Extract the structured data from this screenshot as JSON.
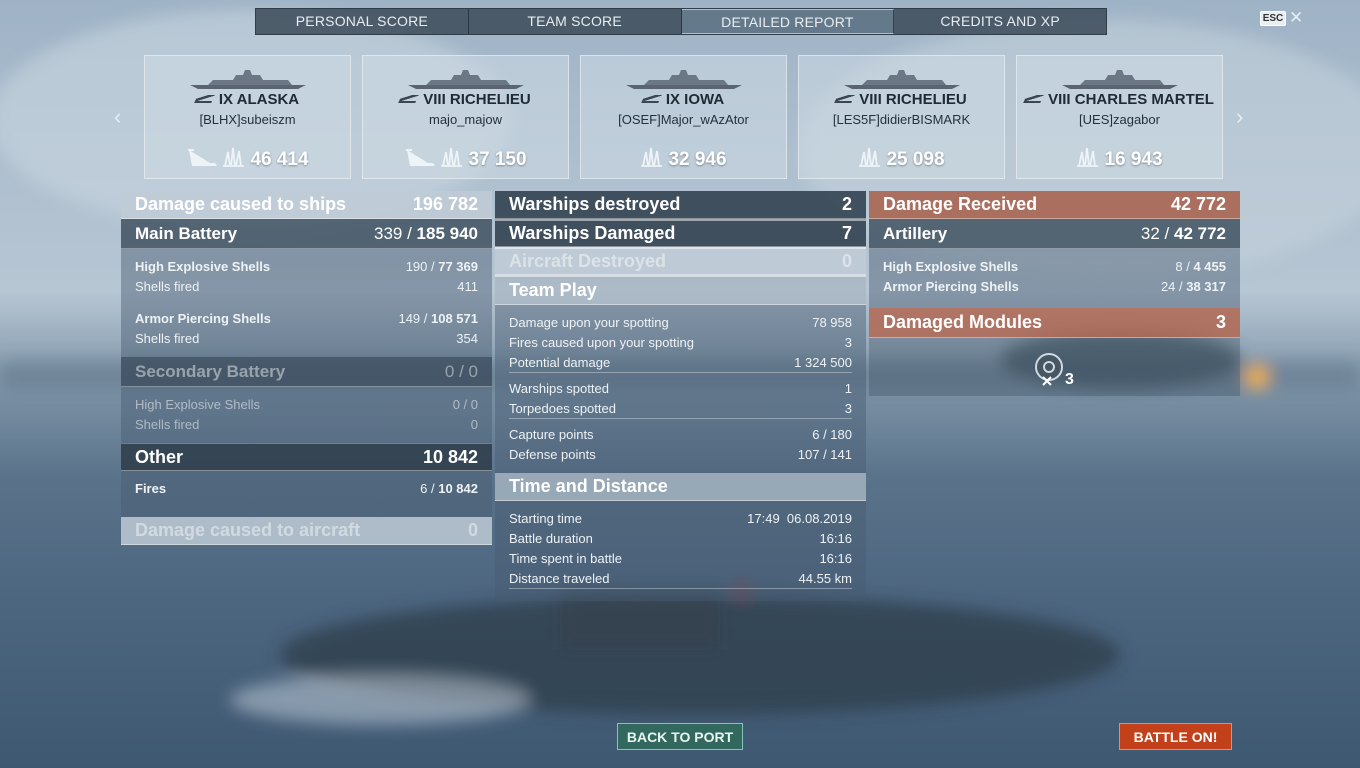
{
  "tabs": [
    {
      "label": "PERSONAL SCORE",
      "active": false
    },
    {
      "label": "TEAM SCORE",
      "active": false
    },
    {
      "label": "DETAILED REPORT",
      "active": true
    },
    {
      "label": "CREDITS AND XP",
      "active": false
    }
  ],
  "esc_label": "ESC",
  "close_icon": "close-icon",
  "ships": [
    {
      "name": "IX ALASKA",
      "player": "[BLHX]subeiszm",
      "damage": "46 414",
      "torpedo_icon": true
    },
    {
      "name": "VIII RICHELIEU",
      "player": "majo_majow",
      "damage": "37 150",
      "torpedo_icon": true
    },
    {
      "name": "IX IOWA",
      "player": "[OSEF]Major_wAzAtor",
      "damage": "32 946",
      "torpedo_icon": false
    },
    {
      "name": "VIII RICHELIEU",
      "player": "[LES5F]didierBISMARK",
      "damage": "25 098",
      "torpedo_icon": false
    },
    {
      "name": "VIII CHARLES MARTEL",
      "player": "[UES]zagabor",
      "damage": "16 943",
      "torpedo_icon": false
    }
  ],
  "left": {
    "header": {
      "label": "Damage caused to ships",
      "value": "196 782"
    },
    "main_battery": {
      "label": "Main Battery",
      "hits": "339 / ",
      "damage": "185 940"
    },
    "he": {
      "label": "High Explosive Shells",
      "hits": "190 / ",
      "damage": "77 369"
    },
    "he_fired": {
      "label": "Shells fired",
      "value": "411"
    },
    "ap": {
      "label": "Armor Piercing Shells",
      "hits": "149 / ",
      "damage": "108 571"
    },
    "ap_fired": {
      "label": "Shells fired",
      "value": "354"
    },
    "secondary": {
      "label": "Secondary Battery",
      "value": "0 / 0"
    },
    "sec_he": {
      "label": "High Explosive Shells",
      "value": "0 / 0"
    },
    "sec_fired": {
      "label": "Shells fired",
      "value": "0"
    },
    "other": {
      "label": "Other",
      "value": "10 842"
    },
    "fires": {
      "label": "Fires",
      "hits": "6 / ",
      "damage": "10 842"
    },
    "aircraft": {
      "label": "Damage caused to aircraft",
      "value": "0"
    }
  },
  "middle": {
    "destroyed": {
      "label": "Warships destroyed",
      "value": "2"
    },
    "damaged": {
      "label": "Warships Damaged",
      "value": "7"
    },
    "aircraft": {
      "label": "Aircraft Destroyed",
      "value": "0"
    },
    "team_play": {
      "label": "Team Play"
    },
    "spotting_dmg": {
      "label": "Damage upon your spotting",
      "value": "78 958"
    },
    "spotting_fires": {
      "label": "Fires caused upon your spotting",
      "value": "3"
    },
    "potential": {
      "label": "Potential damage",
      "value": "1 324 500"
    },
    "ships_spotted": {
      "label": "Warships spotted",
      "value": "1"
    },
    "torp_spotted": {
      "label": "Torpedoes spotted",
      "value": "3"
    },
    "capture": {
      "label": "Capture points",
      "value": "6 / 180"
    },
    "defense": {
      "label": "Defense points",
      "value": "107 / 141"
    },
    "time_dist": {
      "label": "Time and Distance"
    },
    "start": {
      "label": "Starting time",
      "value": "17:49  06.08.2019"
    },
    "duration": {
      "label": "Battle duration",
      "value": "16:16"
    },
    "spent": {
      "label": "Time spent in battle",
      "value": "16:16"
    },
    "distance": {
      "label": "Distance traveled",
      "value": "44.55 km"
    }
  },
  "right": {
    "header": {
      "label": "Damage Received",
      "value": "42 772"
    },
    "artillery": {
      "label": "Artillery",
      "hits": "32 / ",
      "damage": "42 772"
    },
    "he": {
      "label": "High Explosive Shells",
      "hits": "8 / ",
      "damage": "4 455"
    },
    "ap": {
      "label": "Armor Piercing Shells",
      "hits": "24 / ",
      "damage": "38 317"
    },
    "modules": {
      "label": "Damaged Modules",
      "value": "3"
    },
    "module_count": "3"
  },
  "buttons": {
    "back": "BACK TO PORT",
    "battle": "BATTLE ON!"
  }
}
